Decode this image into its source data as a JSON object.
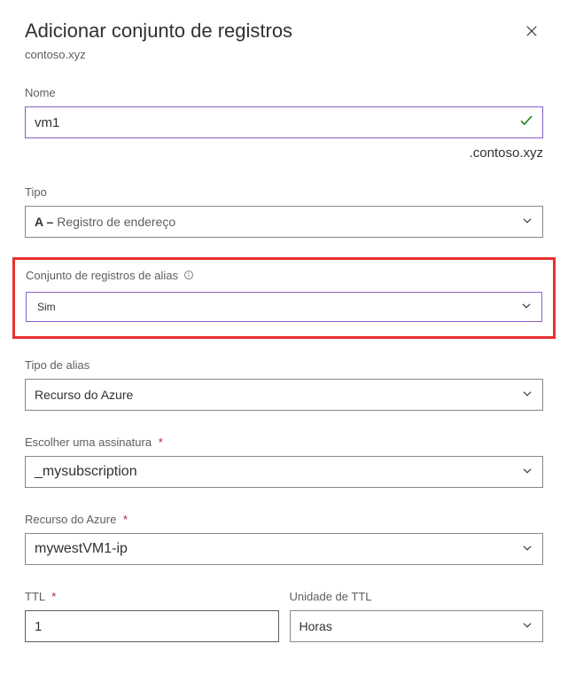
{
  "header": {
    "title": "Adicionar conjunto de registros",
    "subtitle": "contoso.xyz"
  },
  "fields": {
    "name": {
      "label": "Nome",
      "value": "vm1",
      "suffix": ".contoso.xyz"
    },
    "type": {
      "label": "Tipo",
      "prefix": "A –",
      "value": "Registro de endereço"
    },
    "alias_recordset": {
      "label": "Conjunto de registros de alias",
      "value": "Sim"
    },
    "alias_type": {
      "label": "Tipo de alias",
      "value": "Recurso do Azure"
    },
    "subscription": {
      "label": "Escolher uma assinatura",
      "value": "_mysubscription"
    },
    "azure_resource": {
      "label": "Recurso do Azure",
      "value": "mywestVM1-ip"
    },
    "ttl": {
      "label": "TTL",
      "value": "1"
    },
    "ttl_unit": {
      "label": "Unidade de TTL",
      "value": "Horas"
    }
  }
}
